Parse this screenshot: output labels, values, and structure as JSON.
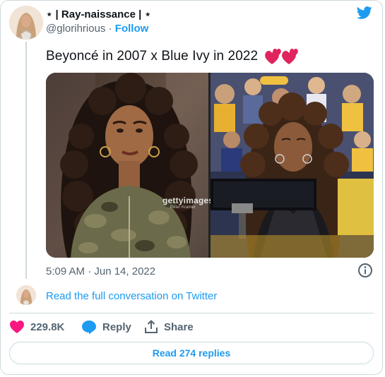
{
  "author": {
    "display_name": "⋆ | Ray-naissance | ⋆",
    "handle": "@glorihrious",
    "separator": "·",
    "follow_label": "Follow"
  },
  "tweet": {
    "text": "Beyoncé in 2007 x Blue Ivy in 2022",
    "emoji": "two-hearts",
    "timestamp": "5:09 AM · Jun 14, 2022"
  },
  "media": {
    "watermark": "gettyimages",
    "watermark_credit": "Peter Kramer"
  },
  "conversation_link": "Read the full conversation on Twitter",
  "actions": {
    "like_count": "229.8K",
    "reply_label": "Reply",
    "share_label": "Share"
  },
  "read_replies_label": "Read 274 replies",
  "icons": {
    "brand": "twitter-bird-icon",
    "info": "info-icon",
    "like": "heart-icon",
    "reply": "reply-bubble-icon",
    "share": "share-icon"
  },
  "colors": {
    "accent": "#1d9bf0",
    "like": "#f91880",
    "muted": "#536471",
    "border": "#cfd9de"
  }
}
